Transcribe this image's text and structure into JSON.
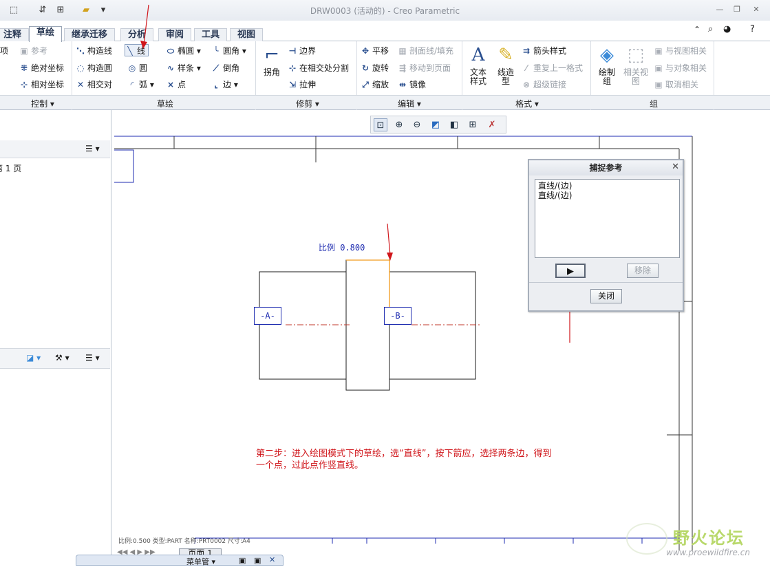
{
  "window": {
    "title": "DRW0003 (活动的) - Creo Parametric",
    "controls": {
      "minimize": "—",
      "restore": "❐",
      "close": "✕"
    }
  },
  "ribbon_tabs": [
    {
      "label": "注释"
    },
    {
      "label": "草绘"
    },
    {
      "label": "继承迁移"
    },
    {
      "label": "分析"
    },
    {
      "label": "审阅"
    },
    {
      "label": "工具"
    },
    {
      "label": "视图"
    }
  ],
  "ribbon": {
    "control": {
      "item_reference": "参考",
      "item_abs_coord": "绝对坐标",
      "item_rel_coord": "相对坐标",
      "item_cut": "项",
      "group": "控制 ▾"
    },
    "sketch": {
      "construction_line": "构造线",
      "construction_circle": "构造圆",
      "intersect": "相交对",
      "line": "线",
      "circle": "圆",
      "arc": "弧",
      "ellipse": "椭圆",
      "spline": "样条",
      "point": "点",
      "fillet": "圆角",
      "chamfer": "倒角",
      "edge": "边",
      "group": "草绘"
    },
    "trim": {
      "corner": "拐角",
      "boundary": "边界",
      "divide": "在相交处分割",
      "stretch": "拉伸",
      "group": "修剪 ▾"
    },
    "edit": {
      "translate": "平移",
      "rotate": "旋转",
      "scale": "缩放",
      "hatch": "剖面线/填充",
      "move_to_page": "移动到页面",
      "mirror": "镜像",
      "group": "编辑 ▾"
    },
    "format": {
      "text_style": "文本\n样式",
      "line_style": "线造\n型",
      "arrow_style": "箭头样式",
      "repeat_format": "重复上一格式",
      "hyperlink": "超级链接",
      "group": "格式 ▾"
    },
    "group_panel": {
      "draw_group": "绘制\n组",
      "related_view": "相关视\n图",
      "relate_view": "与视图相关",
      "relate_object": "与对象相关",
      "unrelate": "取消相关",
      "group": "组"
    }
  },
  "left_panel": {
    "page_item": "第 1 页"
  },
  "drawing": {
    "scale_label": "比例  0.800",
    "datum_a": "-A-",
    "datum_b": "-B-",
    "note_line1": "第二步：进入绘图模式下的草绘，选“直线”，按下箭应，选择两条边，得到",
    "note_line2": "一个点，过此点作竖直线。",
    "status": "比例:0.500    类型:PART    名称:PRT0002    尺寸:A4",
    "page_tab": "页面 1",
    "bottom_strip": "菜单管 ▾"
  },
  "dialog": {
    "title": "捕捉参考",
    "close_icon": "✕",
    "list": [
      "直线/(边)",
      "直线/(边)"
    ],
    "select_button": "",
    "remove_button": "移除",
    "close_button": "关闭"
  },
  "watermark": {
    "text": "野火论坛",
    "url": "www.proewildfire.cn"
  },
  "colors": {
    "accent": "#2a4f8f",
    "drawing_blue": "#1d2bb0",
    "highlight_orange": "#f29b1c",
    "annotation_red": "#d0161b"
  }
}
